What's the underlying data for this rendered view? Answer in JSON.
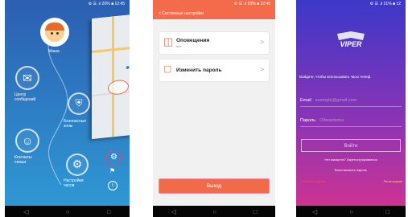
{
  "status_bar": {
    "phone1": "⚙ ☰ .ıl 20% ■ 12:45",
    "phone2": "⚙ ☰ .ıl 20% ■ 12:46",
    "phone3": "⚙ ☰ .ıl 21% ■ 12"
  },
  "nav_glyphs": {
    "back": "◁",
    "home": "○",
    "recent": "□"
  },
  "phone1": {
    "menu": [
      {
        "label": "Маша",
        "icon": "child-avatar-icon"
      },
      {
        "label": "Центр сообщений",
        "icon": "envelope-icon"
      },
      {
        "label": "Безопасные зоны",
        "icon": "shield-icon"
      },
      {
        "label": "Контакты семьи",
        "icon": "person-icon"
      },
      {
        "label": "Настройки часов",
        "icon": "gear-icon"
      }
    ],
    "info_glyph": "i",
    "settings_glyph": "⚙",
    "highlight_color": "#e8407a"
  },
  "phone2": {
    "header_title": "< Системные настройки",
    "items": [
      {
        "title": "Оповещения",
        "subtitle": "вкл.",
        "icon": "speaker-icon"
      },
      {
        "title": "Изменить пароль",
        "subtitle": "",
        "icon": "lock-icon"
      }
    ],
    "chevron": ">",
    "logout_label": "Выход",
    "accent": "#f36b4a"
  },
  "phone3": {
    "brand": "VIPER",
    "tagline": "Войдите, чтобы использовать часы телеф",
    "email_label": "Email",
    "email_placeholder": "example@gmail.com",
    "password_label": "Пароль",
    "password_placeholder": "Обязателен",
    "login_button": "Войти",
    "no_account_text": "Нет аккаунта? Зарегистрироваться",
    "restore_password": "Восстановить пароль",
    "forgot_password": "Забыли пароль",
    "register": "Регистрация"
  }
}
